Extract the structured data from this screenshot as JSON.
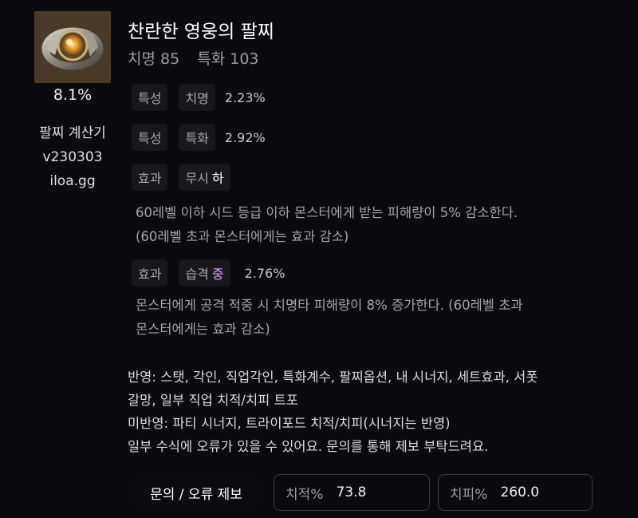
{
  "item": {
    "name": "찬란한 영웅의 팔찌",
    "stat1": "치명 85",
    "stat2": "특화 103",
    "percent": "8.1%"
  },
  "calculator": {
    "name": "팔찌 계산기",
    "version": "v230303",
    "site": "iloa.gg"
  },
  "rows": [
    {
      "type": "특성",
      "stat": "치명",
      "value": "2.23%"
    },
    {
      "type": "특성",
      "stat": "특화",
      "value": "2.92%"
    },
    {
      "type": "효과",
      "stat": "무시",
      "grade": "하",
      "grade_color": "#ffffff",
      "desc1": "60레벨 이하 시드 등급 이하 몬스터에게 받는 피해량이 5% 감소한다.",
      "desc2": "(60레벨 초과 몬스터에게는 효과 감소)"
    },
    {
      "type": "효과",
      "stat": "습격",
      "grade": "중",
      "grade_color": "#e9a8ff",
      "value": "2.76%",
      "desc1": "몬스터에게 공격 적중 시 치명타 피해량이 8% 증가한다. (60레벨 초과",
      "desc2": "몬스터에게는 효과 감소)"
    }
  ],
  "notes": {
    "line1": "반영: 스탯, 각인, 직업각인, 특화계수, 팔찌옵션, 내 시너지, 세트효과, 서폿",
    "line2": "갈망, 일부 직업 치적/치피 트포",
    "line3": "미반영: 파티 시너지, 트라이포드 치적/치피(시너지는 반영)",
    "line4": "일부 수식에 오류가 있을 수 있어요. 문의를 통해 제보 부탁드려요."
  },
  "footer": {
    "report_label": "문의 / 오류 제보",
    "crit_rate_label": "치적%",
    "crit_rate_value": "73.8",
    "crit_dmg_label": "치피%",
    "crit_dmg_value": "260.0"
  }
}
